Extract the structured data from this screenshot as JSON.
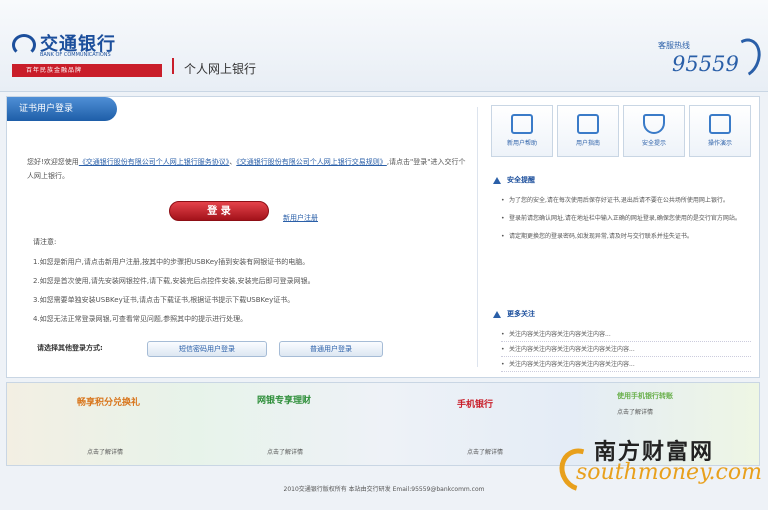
{
  "header": {
    "bank_name_cn": "交通银行",
    "bank_name_en": "BANK OF COMMUNICATIONS",
    "tagline": "百年民族金融品牌",
    "product": "个人网上银行",
    "hotline_label": "客服热线",
    "hotline_number": "95559"
  },
  "login": {
    "tab_label": "证书用户登录",
    "intro_prefix": "您好!欢迎您使用",
    "agreement1": "《交通银行股份有限公司个人网上银行服务协议》",
    "intro_mid": "、",
    "agreement2": "《交通银行股份有限公司个人网上银行交易规则》",
    "intro_suffix": ",请点击\"登录\"进入交行个人网上银行。",
    "login_button": "登 录",
    "register_link": "新用户注册",
    "notice_title": "请注意:",
    "notices": [
      "1.如您是新用户,请点击新用户注册,按其中的步骤把USBKey插到安装有网银证书的电脑。",
      "2.如您是首次使用,请先安装网银控件,请下载,安装完后点控件安装,安装完后即可登录网银。",
      "3.如您需要单独安装USBKey证书,请点击下载证书,根据证书提示下载USBKey证书。",
      "4.如您无法正常登录网银,可查看常见问题,参照其中的提示进行处理。"
    ],
    "other_login_label": "请选择其他登录方式:",
    "other_buttons": [
      "短信密码用户登录",
      "普通用户登录"
    ]
  },
  "quick_links": [
    {
      "label": "新用户帮助",
      "icon": "user-help-icon"
    },
    {
      "label": "用户指南",
      "icon": "guide-icon"
    },
    {
      "label": "安全提示",
      "icon": "shield-icon"
    },
    {
      "label": "操作演示",
      "icon": "monitor-icon"
    }
  ],
  "security": {
    "title": "安全提醒",
    "tips": [
      "为了您的安全,请在每次使用后保存好证书,退出后请不要在公共场所使用网上银行。",
      "登录前请您确认网址,请在地址栏中输入正确的网址登录,确保您使用的是交行官方网站。",
      "请定期更换您的登录密码,如发现异常,请及时与交行联系并挂失证书。"
    ]
  },
  "more": {
    "title": "更多关注",
    "items": [
      "关注内容关注内容关注内容关注内容...",
      "关注内容关注内容关注内容关注内容关注内容...",
      "关注内容关注内容关注内容关注内容关注内容..."
    ]
  },
  "banner": {
    "items": [
      {
        "text": "畅享积分兑换礼",
        "link": "点击了解详情"
      },
      {
        "text": "网银专享理财",
        "link": "点击了解详情"
      },
      {
        "text": "手机银行",
        "link": "点击了解详情"
      },
      {
        "text": "使用手机银行转账",
        "link": "点击了解详情"
      }
    ]
  },
  "footer": {
    "text": "2010交通银行版权所有   本站由交行研发   Email:95559@bankcomm.com"
  },
  "watermark": {
    "cn": "南方财富网",
    "en": "southmoney.com"
  }
}
